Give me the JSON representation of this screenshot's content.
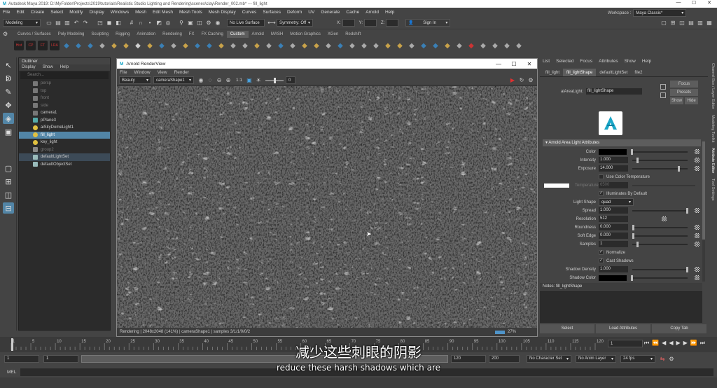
{
  "window": {
    "title": "Autodesk Maya 2019: D:\\MyFolder\\Projects\\2019\\tutorials\\Realistic Studio Lighting and Rendering\\scenes\\clay\\Render_002.mb* --- fill_light"
  },
  "menubar": [
    "File",
    "Edit",
    "Create",
    "Select",
    "Modify",
    "Display",
    "Windows",
    "Mesh",
    "Edit Mesh",
    "Mesh Tools",
    "Mesh Display",
    "Curves",
    "Surfaces",
    "Deform",
    "UV",
    "Generate",
    "Cache",
    "Arnold",
    "Help"
  ],
  "workspace": {
    "label": "Workspace :",
    "value": "Maya Classic*"
  },
  "statusline": {
    "mode": "Modeling",
    "live_surface": "No Live Surface",
    "symmetry": "Symmetry: Off",
    "sign_in": "Sign In",
    "x_label": "X:",
    "y_label": "Y:",
    "z_label": "Z:"
  },
  "shelf_tabs": [
    "Curves / Surfaces",
    "Poly Modeling",
    "Sculpting",
    "Rigging",
    "Animation",
    "Rendering",
    "FX",
    "FX Caching",
    "Custom",
    "Arnold",
    "MASH",
    "Motion Graphics",
    "XGen",
    "Redshift"
  ],
  "shelf_active": "Custom",
  "shelf_icon_labels": [
    "Hist",
    "CP",
    "FT",
    "LRA"
  ],
  "outliner": {
    "title": "Outliner",
    "menus": [
      "Display",
      "Show",
      "Help"
    ],
    "search_placeholder": "Search...",
    "items": [
      {
        "label": "persp",
        "kind": "camera",
        "state": "dim"
      },
      {
        "label": "top",
        "kind": "camera",
        "state": "dim"
      },
      {
        "label": "front",
        "kind": "camera",
        "state": "dim"
      },
      {
        "label": "side",
        "kind": "camera",
        "state": "dim"
      },
      {
        "label": "camera1",
        "kind": "camera",
        "state": ""
      },
      {
        "label": "pPlane3",
        "kind": "mesh",
        "state": ""
      },
      {
        "label": "aiSkyDomeLight1",
        "kind": "light",
        "state": ""
      },
      {
        "label": "fill_light",
        "kind": "light",
        "state": "sel1"
      },
      {
        "label": "key_light",
        "kind": "light",
        "state": ""
      },
      {
        "label": "group2",
        "kind": "group",
        "state": "dim"
      },
      {
        "label": "defaultLightSet",
        "kind": "set",
        "state": "sel2"
      },
      {
        "label": "defaultObjectSet",
        "kind": "set",
        "state": ""
      }
    ]
  },
  "renderview": {
    "title": "Arnold RenderView",
    "menus": [
      "File",
      "Window",
      "View",
      "Render"
    ],
    "aov": "Beauty",
    "camera": "cameraShape1",
    "ratio": "1:1",
    "exposure": "0",
    "status": "Rendering | 2048x2048 (141%) | cameraShape1 | samples 3/1/1/0/0/2",
    "zoom": "27%"
  },
  "attribute_editor": {
    "menus": [
      "List",
      "Selected",
      "Focus",
      "Attributes",
      "Show",
      "Help"
    ],
    "tabs": [
      "fill_light",
      "fill_lightShape",
      "defaultLightSet",
      "file2"
    ],
    "active_tab": "fill_lightShape",
    "node_label": "aiAreaLight:",
    "node_value": "fill_lightShape",
    "buttons": {
      "focus": "Focus",
      "presets": "Presets",
      "show": "Show",
      "hide": "Hide"
    },
    "section": "Arnold Area Light Attributes",
    "attrs": {
      "color": "Color",
      "intensity": {
        "label": "Intensity",
        "value": "1.000",
        "frac": 0.08
      },
      "exposure": {
        "label": "Exposure",
        "value": "14.000",
        "frac": 0.82
      },
      "use_color_temp": "Use Color Temperature",
      "temperature": {
        "label": "Temperature",
        "value": "6500"
      },
      "illuminates": "Illuminates By Default",
      "light_shape": {
        "label": "Light Shape",
        "value": "quad"
      },
      "spread": {
        "label": "Spread",
        "value": "1.000",
        "frac": 0.98
      },
      "resolution": {
        "label": "Resolution",
        "value": "512"
      },
      "roundness": {
        "label": "Roundness",
        "value": "0.000",
        "frac": 0.0
      },
      "soft_edge": {
        "label": "Soft Edge",
        "value": "0.000",
        "frac": 0.0
      },
      "samples": {
        "label": "Samples",
        "value": "1",
        "frac": 0.07
      },
      "normalize": "Normalize",
      "cast_shadows": "Cast Shadows",
      "shadow_density": {
        "label": "Shadow Density",
        "value": "1.000",
        "frac": 0.98
      },
      "shadow_color": "Shadow Color"
    },
    "notes": "Notes: fill_lightShape",
    "bottom_buttons": [
      "Select",
      "Load Attributes",
      "Copy Tab"
    ]
  },
  "vertical_tabs": [
    "Channel Box / Layer Editor",
    "Modeling Toolkit",
    "Attribute Editor",
    "Tool Settings"
  ],
  "timeline": {
    "ticks": [
      "1",
      "5",
      "10",
      "15",
      "20",
      "25",
      "30",
      "35",
      "40",
      "45",
      "50",
      "55",
      "60",
      "65",
      "70",
      "75",
      "80",
      "85",
      "90",
      "95",
      "100",
      "105",
      "110",
      "115",
      "120"
    ],
    "current": "1"
  },
  "range": {
    "start": "1",
    "inner_start": "1",
    "inner_end": "120",
    "end": "120",
    "end2": "200",
    "char_set": "No Character Set",
    "anim_layer": "No Anim Layer",
    "fps": "24 fps"
  },
  "cmdline": {
    "label": "MEL"
  },
  "subtitles": {
    "cn": "减少这些刺眼的阴影",
    "en": "reduce these harsh shadows which are"
  }
}
